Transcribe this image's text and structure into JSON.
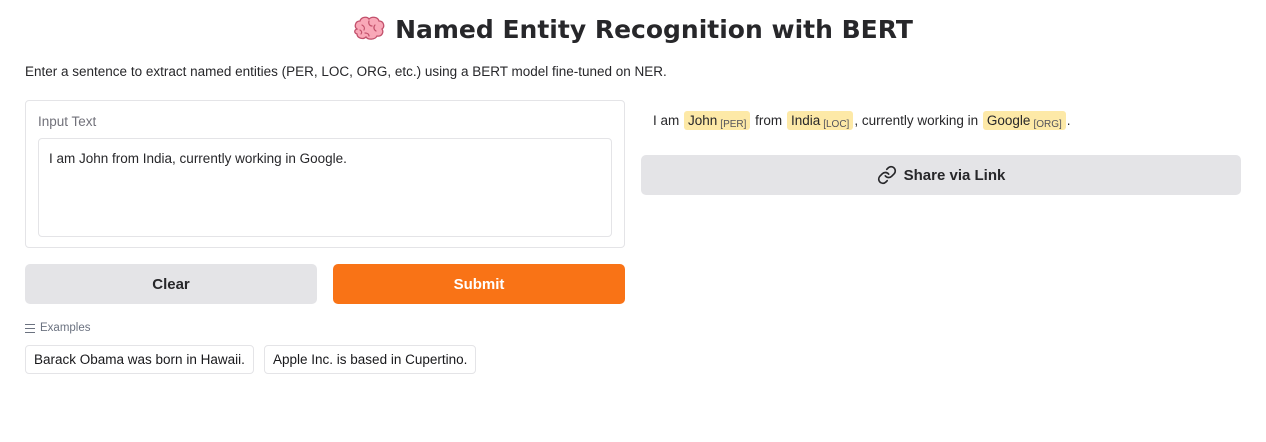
{
  "header": {
    "title": "Named Entity Recognition with BERT",
    "title_icon": "brain-emoji",
    "description": "Enter a sentence to extract named entities (PER, LOC, ORG, etc.) using a BERT model fine-tuned on NER."
  },
  "input": {
    "label": "Input Text",
    "value": "I am John from India, currently working in Google."
  },
  "buttons": {
    "clear": "Clear",
    "submit": "Submit",
    "share": "Share via Link"
  },
  "colors": {
    "submit": "#f97316",
    "entity_highlight": "#fde9a7",
    "secondary_button": "#e4e4e7"
  },
  "examples": {
    "label": "Examples",
    "items": [
      "Barack Obama was born in Hawaii.",
      "Apple Inc. is based in Cupertino."
    ]
  },
  "output": {
    "segments": [
      {
        "text": "I am "
      },
      {
        "text": "John",
        "tag": "[PER]"
      },
      {
        "text": " from "
      },
      {
        "text": "India",
        "tag": "[LOC]"
      },
      {
        "text": ", currently working in "
      },
      {
        "text": "Google",
        "tag": "[ORG]"
      },
      {
        "text": "."
      }
    ]
  }
}
